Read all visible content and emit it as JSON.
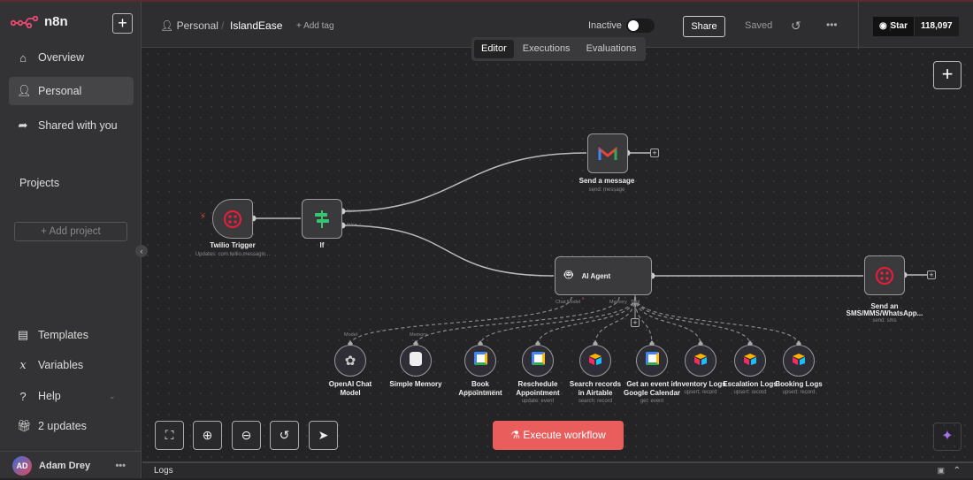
{
  "sidebar": {
    "brand": "n8n",
    "new_icon": "plus-icon",
    "items": [
      {
        "label": "Overview",
        "icon": "home-icon"
      },
      {
        "label": "Personal",
        "icon": "user-icon",
        "active": true
      },
      {
        "label": "Shared with you",
        "icon": "share-icon"
      }
    ],
    "projects_heading": "Projects",
    "add_project": "+ Add project",
    "bottom_items": [
      {
        "label": "Templates",
        "icon": "templates-icon"
      },
      {
        "label": "Variables",
        "icon": "variables-icon"
      },
      {
        "label": "Help",
        "icon": "help-icon"
      },
      {
        "label": "2 updates",
        "icon": "gift-icon"
      }
    ],
    "user": {
      "initials": "AD",
      "name": "Adam Drey"
    }
  },
  "header": {
    "breadcrumb_project": "Personal",
    "workflow_name": "IslandEase",
    "add_tag": "+ Add tag",
    "status": "Inactive",
    "active": false,
    "share": "Share",
    "saved": "Saved",
    "github_star": "Star",
    "github_count": "118,097"
  },
  "tabs": [
    {
      "label": "Editor",
      "active": true
    },
    {
      "label": "Executions"
    },
    {
      "label": "Evaluations"
    }
  ],
  "nodes": {
    "trigger": {
      "label": "Twilio Trigger",
      "sub": "Updates: com.twilio.messagin..."
    },
    "if": {
      "label": "If",
      "true": "true",
      "false": "false"
    },
    "gmail": {
      "label": "Send a message",
      "sub": "send: message"
    },
    "agent": {
      "label": "AI Agent",
      "port_model": "Chat Model",
      "port_memory": "Memory",
      "port_tool": "Tool"
    },
    "sms": {
      "label1": "Send an",
      "label2": "SMS/MMS/WhatsApp...",
      "sub": "send: sms"
    }
  },
  "subnodes": [
    {
      "label": "OpenAI Chat Model",
      "sub": "",
      "port": "Model",
      "icon": "openai-icon"
    },
    {
      "label": "Simple Memory",
      "sub": "",
      "port": "Memory",
      "icon": "database-icon"
    },
    {
      "label": "Book Appointment",
      "sub": "create: event",
      "icon": "google-calendar-icon"
    },
    {
      "label": "Reschedule Appointment",
      "sub": "update: event",
      "icon": "google-calendar-icon"
    },
    {
      "label": "Search records in Airtable",
      "sub": "search: record",
      "icon": "airtable-icon"
    },
    {
      "label": "Get an event in Google Calendar",
      "sub": "get: event",
      "icon": "google-calendar-icon"
    },
    {
      "label": "Inventory Logs",
      "sub": "upsert: record",
      "icon": "airtable-icon"
    },
    {
      "label": "Escalation Logs",
      "sub": "upsert: record",
      "icon": "airtable-icon"
    },
    {
      "label": "Booking Logs",
      "sub": "upsert: record",
      "icon": "airtable-icon"
    }
  ],
  "execute": "Execute workflow",
  "logs": "Logs",
  "colors": {
    "accent": "#ea5d5d",
    "brand": "#ea4b71",
    "twilio": "#e31e3c",
    "if": "#35c66f"
  }
}
